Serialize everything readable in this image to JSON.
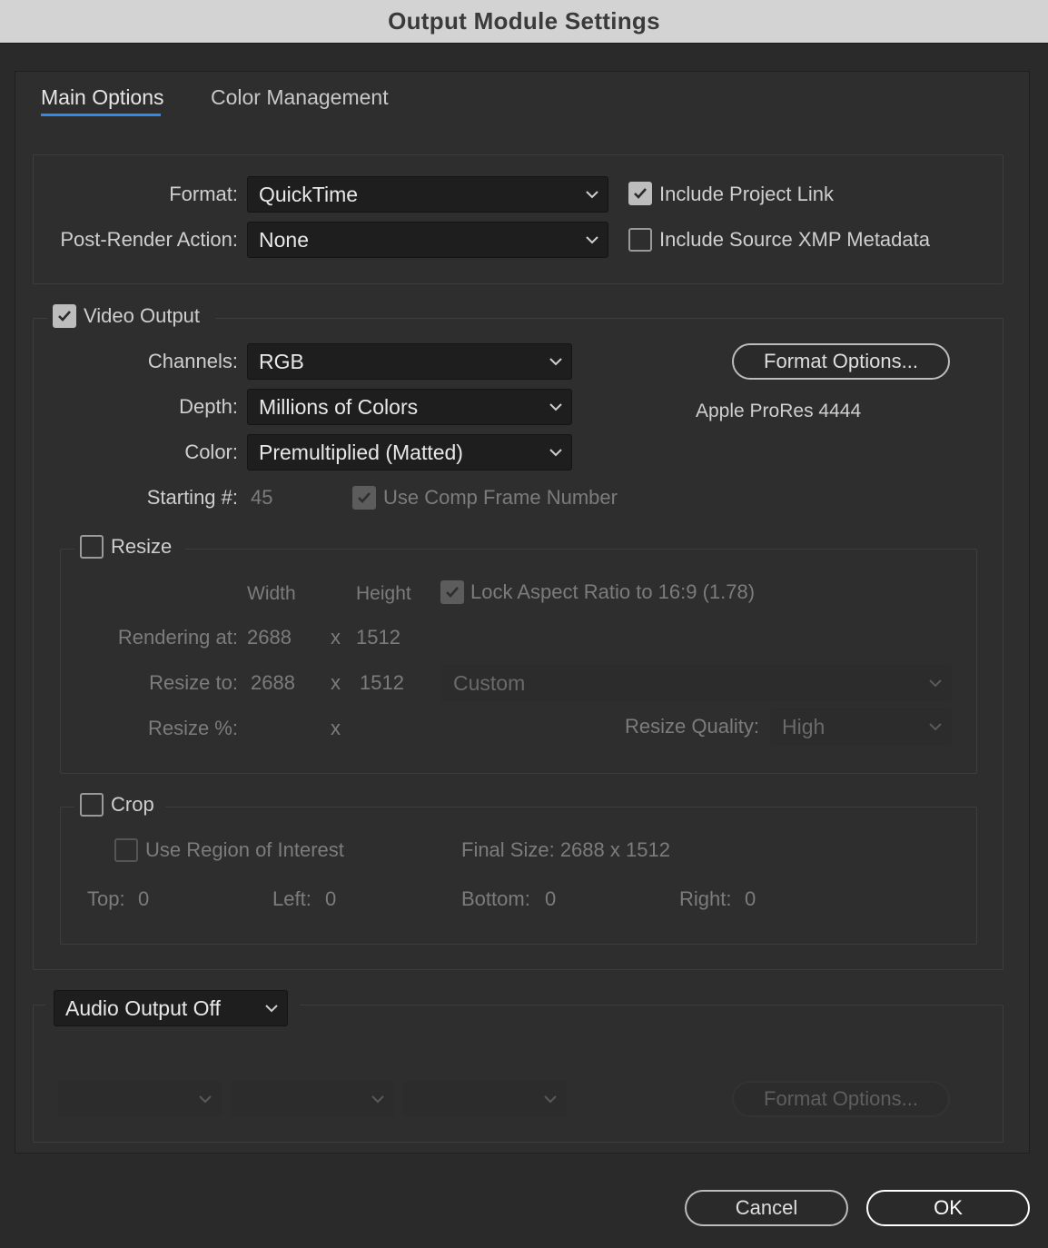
{
  "window": {
    "title": "Output Module Settings"
  },
  "tabs": [
    {
      "label": "Main Options",
      "active": true
    },
    {
      "label": "Color Management",
      "active": false
    }
  ],
  "format_section": {
    "format_label": "Format:",
    "format_value": "QuickTime",
    "post_render_label": "Post-Render Action:",
    "post_render_value": "None",
    "include_project_link": {
      "label": "Include Project Link",
      "checked": true
    },
    "include_xmp": {
      "label": "Include Source XMP Metadata",
      "checked": false
    }
  },
  "video_output": {
    "label": "Video Output",
    "checked": true,
    "channels_label": "Channels:",
    "channels_value": "RGB",
    "depth_label": "Depth:",
    "depth_value": "Millions of Colors",
    "color_label": "Color:",
    "color_value": "Premultiplied (Matted)",
    "starting_label": "Starting #:",
    "starting_value": "45",
    "use_comp_frame": {
      "label": "Use Comp Frame Number",
      "checked": true
    },
    "format_options_button": "Format Options...",
    "codec": "Apple ProRes 4444"
  },
  "resize": {
    "label": "Resize",
    "checked": false,
    "width_header": "Width",
    "height_header": "Height",
    "lock_aspect": {
      "label": "Lock Aspect Ratio to 16:9 (1.78)",
      "checked": true
    },
    "rendering_label": "Rendering at:",
    "rendering_width": "2688",
    "rendering_height": "1512",
    "resize_to_label": "Resize to:",
    "resize_to_width": "2688",
    "resize_to_height": "1512",
    "preset_value": "Custom",
    "resize_pct_label": "Resize %:",
    "x_sign": "x",
    "quality_label": "Resize Quality:",
    "quality_value": "High"
  },
  "crop": {
    "label": "Crop",
    "checked": false,
    "use_roi": {
      "label": "Use Region of Interest",
      "checked": false
    },
    "final_size": "Final Size: 2688 x 1512",
    "top_label": "Top:",
    "top_value": "0",
    "left_label": "Left:",
    "left_value": "0",
    "bottom_label": "Bottom:",
    "bottom_value": "0",
    "right_label": "Right:",
    "right_value": "0"
  },
  "audio": {
    "dropdown_value": "Audio Output Off",
    "format_options_button": "Format Options..."
  },
  "footer": {
    "cancel": "Cancel",
    "ok": "OK"
  },
  "colors": {
    "accent": "#2d8ceb",
    "background": "#2a2a2a",
    "titlebar": "#d3d3d3"
  },
  "icons": {
    "dropdown": "chevron-down-icon",
    "check": "checkmark-icon"
  }
}
